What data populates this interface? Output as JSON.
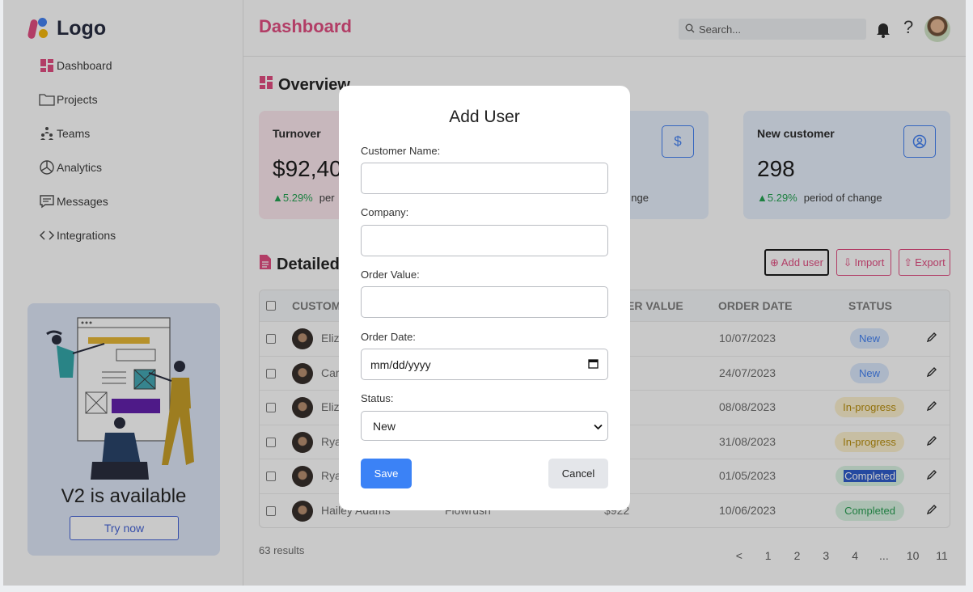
{
  "brand": {
    "name": "Logo"
  },
  "sidebar": {
    "items": [
      {
        "label": "Dashboard",
        "icon": "dashboard-icon"
      },
      {
        "label": "Projects",
        "icon": "folder-icon"
      },
      {
        "label": "Teams",
        "icon": "team-icon"
      },
      {
        "label": "Analytics",
        "icon": "pie-chart-icon"
      },
      {
        "label": "Messages",
        "icon": "message-icon"
      },
      {
        "label": "Integrations",
        "icon": "code-icon"
      }
    ],
    "promo": {
      "title": "V2 is available",
      "button": "Try now"
    }
  },
  "header": {
    "title": "Dashboard",
    "search_placeholder": "Search..."
  },
  "overview": {
    "title": "Overview",
    "cards": [
      {
        "label": "Turnover",
        "value": "$92,40",
        "change": "5.29%",
        "change_text": "per"
      },
      {
        "label": "",
        "value": "",
        "change": "",
        "change_text": "nge",
        "icon": "$"
      },
      {
        "label": "New customer",
        "value": "298",
        "change": "5.29%",
        "change_text": "period of change"
      }
    ]
  },
  "detail": {
    "title": "Detailed",
    "actions": {
      "add": "Add user",
      "import": "Import",
      "export": "Export"
    },
    "columns": {
      "customer": "CUSTOM",
      "order_value": "ER VALUE",
      "order_date": "ORDER DATE",
      "status": "STATUS"
    },
    "rows": [
      {
        "name": "Eliz",
        "company": "",
        "value": "",
        "date": "10/07/2023",
        "status": "New"
      },
      {
        "name": "Car",
        "company": "",
        "value": "",
        "date": "24/07/2023",
        "status": "New"
      },
      {
        "name": "Eliz",
        "company": "",
        "value": "",
        "date": "08/08/2023",
        "status": "In-progress"
      },
      {
        "name": "Rya",
        "company": "",
        "value": "",
        "date": "31/08/2023",
        "status": "In-progress"
      },
      {
        "name": "Rya",
        "company": "",
        "value": "",
        "date": "01/05/2023",
        "status": "Completed"
      },
      {
        "name": "Hailey Adams",
        "company": "Flowrush",
        "value": "$922",
        "date": "10/06/2023",
        "status": "Completed"
      }
    ],
    "results": "63 results",
    "pages": [
      "<",
      "1",
      "2",
      "3",
      "4",
      "...",
      "10",
      "11",
      ">"
    ]
  },
  "modal": {
    "title": "Add User",
    "fields": {
      "customer_name": "Customer Name:",
      "company": "Company:",
      "order_value": "Order Value:",
      "order_date": "Order Date:",
      "order_date_value": "mm/dd/yyyy",
      "status": "Status:",
      "status_value": "New"
    },
    "save": "Save",
    "cancel": "Cancel"
  },
  "colors": {
    "accent": "#e0457b",
    "primary": "#3b82f6"
  }
}
